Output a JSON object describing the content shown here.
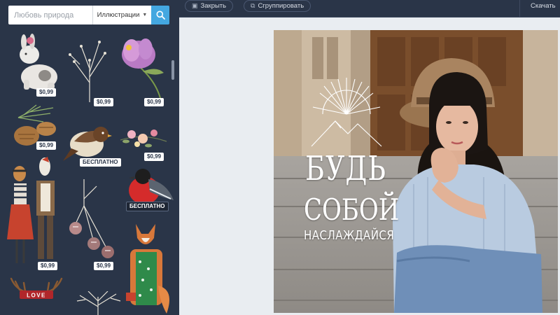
{
  "search": {
    "placeholder": "Любовь природа",
    "category": "Иллюстрации",
    "search_icon": "search-icon"
  },
  "toolbar": {
    "close_label": "Закрыть",
    "group_label": "Сгруппировать",
    "download_label": "Скачать"
  },
  "stickers": [
    {
      "name": "rabbit",
      "price": "$0,99"
    },
    {
      "name": "dry-twig",
      "price": "$0,99"
    },
    {
      "name": "pink-flower",
      "price": "$0,99"
    },
    {
      "name": "pine-cones",
      "price": "$0,99"
    },
    {
      "name": "sparrow",
      "price": "БЕСПЛАТНО"
    },
    {
      "name": "flower-branch",
      "price": "$0,99"
    },
    {
      "name": "bullfinch",
      "price": "БЕСПЛАТНО"
    },
    {
      "name": "animal-couple",
      "price": "$0,99"
    },
    {
      "name": "berry-twig",
      "price": "$0,99"
    },
    {
      "name": "fox-lady",
      "price": ""
    },
    {
      "name": "love-antlers",
      "price": ""
    },
    {
      "name": "branches",
      "price": ""
    }
  ],
  "love_text": "LOVE",
  "design": {
    "line1": "БУДЬ",
    "line2": "СОБОЙ",
    "line3": "НАСЛАЖДАЙСЯ"
  },
  "colors": {
    "sidebar": "#2a3548",
    "accent": "#44a7e0",
    "canvas_bg": "#e9edf1"
  }
}
